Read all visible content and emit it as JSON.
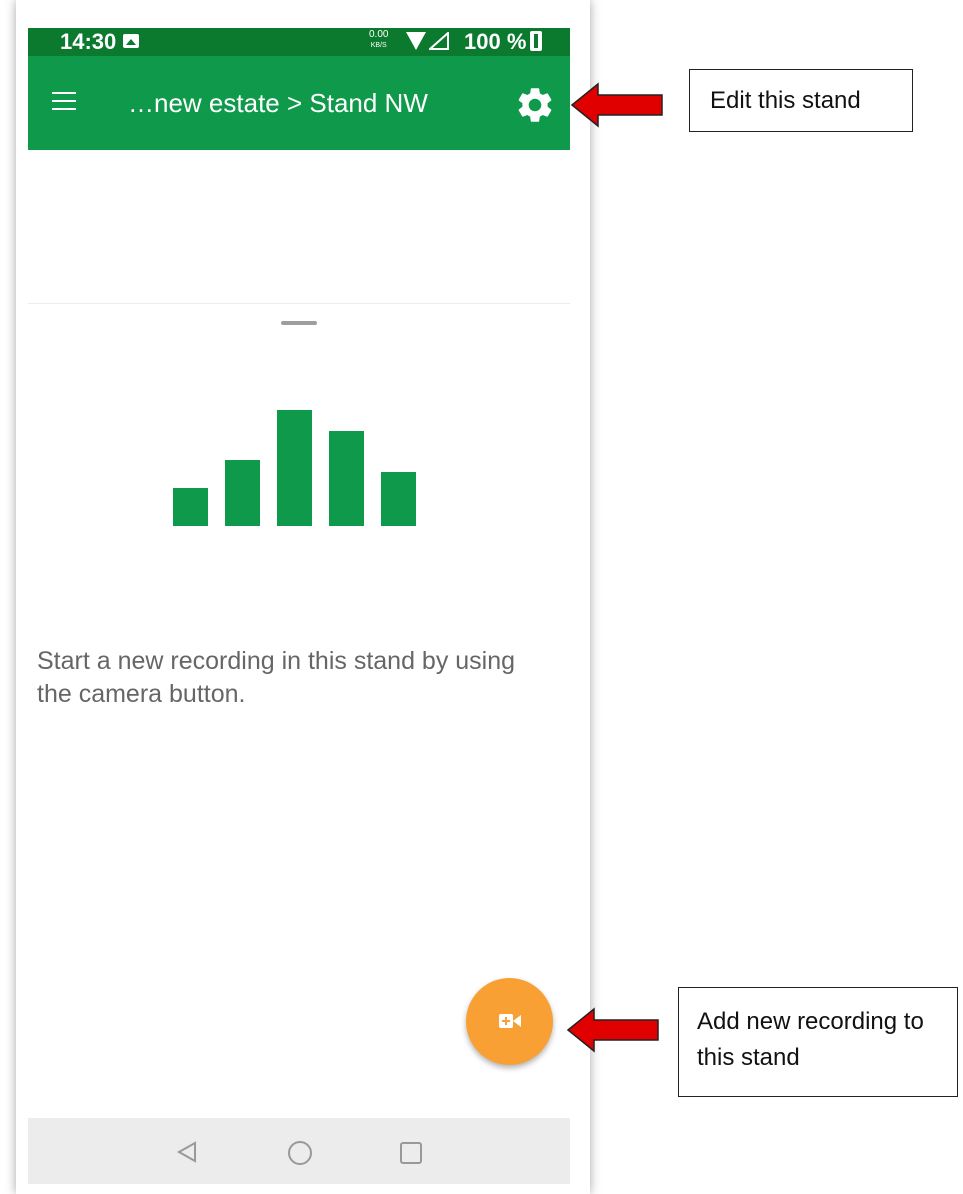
{
  "status_bar": {
    "time": "14:30",
    "speed_value": "0.00",
    "speed_unit": "KB/S",
    "battery": "100 %"
  },
  "app_bar": {
    "title": "…new estate > Stand NW",
    "menu_icon": "hamburger-menu-icon",
    "settings_icon": "gear-icon"
  },
  "empty_state": {
    "illustration_icon": "bar-chart-icon",
    "message": "Start a new recording in this stand by using the camera button."
  },
  "fab": {
    "icon": "video-camera-add-icon"
  },
  "nav_bar": {
    "back_icon": "back-triangle-icon",
    "home_icon": "home-circle-icon",
    "recents_icon": "recents-square-icon"
  },
  "annotations": {
    "edit_stand": "Edit this stand",
    "add_recording": "Add new recording to this stand"
  },
  "colors": {
    "status_bar": "#0b7a2e",
    "app_bar": "#0f9a4b",
    "chart_green": "#0f9a4b",
    "fab": "#f9a035",
    "arrow_red": "#e00000"
  }
}
